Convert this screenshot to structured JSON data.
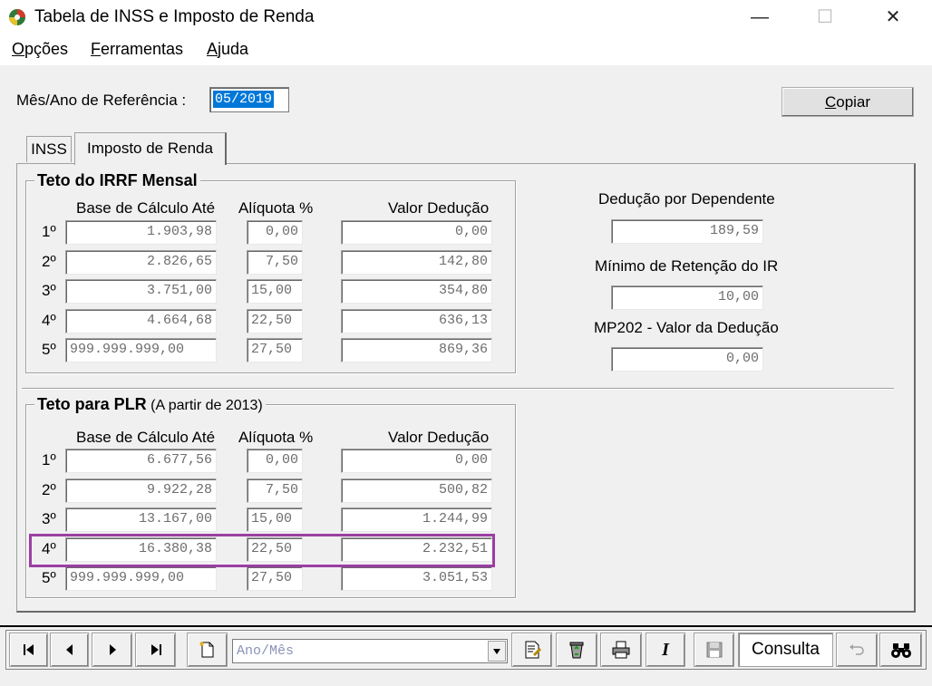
{
  "window": {
    "title": "Tabela de INSS e Imposto de Renda",
    "minimize": "—",
    "maximize": "☐",
    "close": "✕"
  },
  "menu": {
    "items": [
      "Opções",
      "Ferramentas",
      "Ajuda"
    ],
    "underline": [
      "O",
      "F",
      "A"
    ]
  },
  "header": {
    "ref_label": "Mês/Ano de Referência :",
    "ref_value": "05/2019",
    "copy_button": "Copiar"
  },
  "tabs": [
    {
      "label": "INSS",
      "active": false
    },
    {
      "label": "Imposto de Renda",
      "active": true
    }
  ],
  "irrf": {
    "title": "Teto do IRRF Mensal",
    "headers": {
      "base": "Base de Cálculo Até",
      "aliquota": "Alíquota %",
      "deducao": "Valor Dedução"
    },
    "rows": [
      {
        "ord": "1º",
        "base": "1.903,98",
        "aliq": "0,00",
        "ded": "0,00"
      },
      {
        "ord": "2º",
        "base": "2.826,65",
        "aliq": "7,50",
        "ded": "142,80"
      },
      {
        "ord": "3º",
        "base": "3.751,00",
        "aliq": "15,00",
        "ded": "354,80"
      },
      {
        "ord": "4º",
        "base": "4.664,68",
        "aliq": "22,50",
        "ded": "636,13"
      },
      {
        "ord": "5º",
        "base": "999.999.999,00",
        "aliq": "27,50",
        "ded": "869,36"
      }
    ]
  },
  "side": {
    "dep_label": "Dedução por Dependente",
    "dep_value": "189,59",
    "min_label": "Mínimo de Retenção do IR",
    "min_value": "10,00",
    "mp_label": "MP202 - Valor da Dedução",
    "mp_value": "0,00"
  },
  "plr": {
    "title": "Teto para PLR",
    "subtitle": " (A partir de 2013)",
    "headers": {
      "base": "Base de Cálculo Até",
      "aliquota": "Alíquota %",
      "deducao": "Valor Dedução"
    },
    "rows": [
      {
        "ord": "1º",
        "base": "6.677,56",
        "aliq": "0,00",
        "ded": "0,00"
      },
      {
        "ord": "2º",
        "base": "9.922,28",
        "aliq": "7,50",
        "ded": "500,82"
      },
      {
        "ord": "3º",
        "base": "13.167,00",
        "aliq": "15,00",
        "ded": "1.244,99"
      },
      {
        "ord": "4º",
        "base": "16.380,38",
        "aliq": "22,50",
        "ded": "2.232,51"
      },
      {
        "ord": "5º",
        "base": "999.999.999,00",
        "aliq": "27,50",
        "ded": "3.051,53"
      }
    ],
    "highlight_color": "#9b3fa3"
  },
  "toolbar": {
    "combo_placeholder": "Ano/Mês",
    "mode": "Consulta"
  },
  "colors": {
    "selection": "#0078d7"
  }
}
